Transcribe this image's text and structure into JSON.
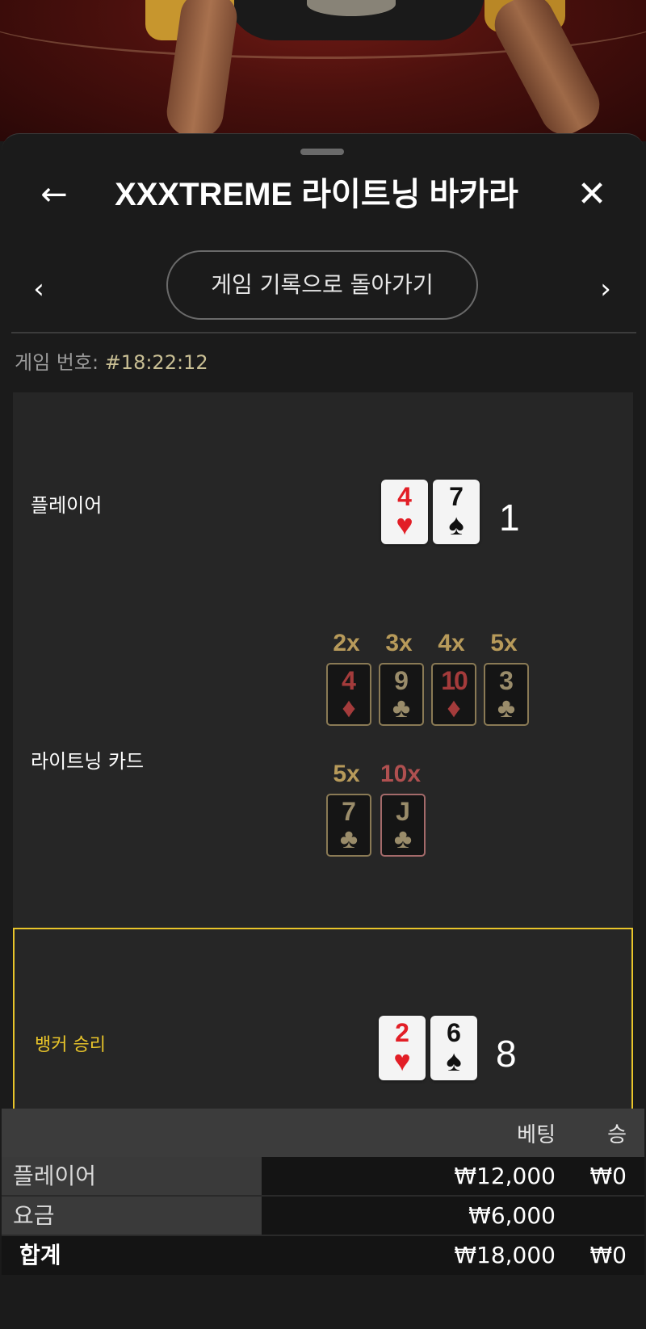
{
  "header": {
    "title": "XXXTREME 라이트닝 바카라",
    "back_icon": "←",
    "close_icon": "✕"
  },
  "nav": {
    "back_to_history_label": "게임 기록으로 돌아가기",
    "prev_icon": "‹",
    "next_icon": "›"
  },
  "game": {
    "number_label": "게임 번호:",
    "number_value": "#18:22:12"
  },
  "player": {
    "label": "플레이어",
    "cards": [
      {
        "rank": "4",
        "suit": "♥",
        "color": "red"
      },
      {
        "rank": "7",
        "suit": "♠",
        "color": "black"
      }
    ],
    "score": "1"
  },
  "lightning": {
    "label": "라이트닝 카드",
    "cards": [
      {
        "multiplier": "2x",
        "rank": "4",
        "suit": "♦",
        "color": "red"
      },
      {
        "multiplier": "3x",
        "rank": "9",
        "suit": "♣",
        "color": "dark"
      },
      {
        "multiplier": "4x",
        "rank": "10",
        "suit": "♦",
        "color": "red"
      },
      {
        "multiplier": "5x",
        "rank": "3",
        "suit": "♣",
        "color": "dark"
      },
      {
        "multiplier": "5x",
        "rank": "7",
        "suit": "♣",
        "color": "dark"
      },
      {
        "multiplier": "10x",
        "rank": "J",
        "suit": "♣",
        "color": "dark"
      }
    ]
  },
  "banker": {
    "label": "뱅커 승리",
    "cards": [
      {
        "rank": "2",
        "suit": "♥",
        "color": "red"
      },
      {
        "rank": "6",
        "suit": "♠",
        "color": "black"
      }
    ],
    "score": "8"
  },
  "bets": {
    "columns": {
      "bet": "베팅",
      "win": "승"
    },
    "rows": [
      {
        "name": "플레이어",
        "bet": "₩12,000",
        "win": "₩0"
      },
      {
        "name": "요금",
        "bet": "₩6,000",
        "win": ""
      }
    ],
    "total": {
      "name": "합계",
      "bet": "₩18,000",
      "win": "₩0"
    }
  },
  "colors": {
    "winner_highlight": "#e8c42a",
    "red_suit": "#e21e26",
    "panel_bg": "#262626"
  }
}
